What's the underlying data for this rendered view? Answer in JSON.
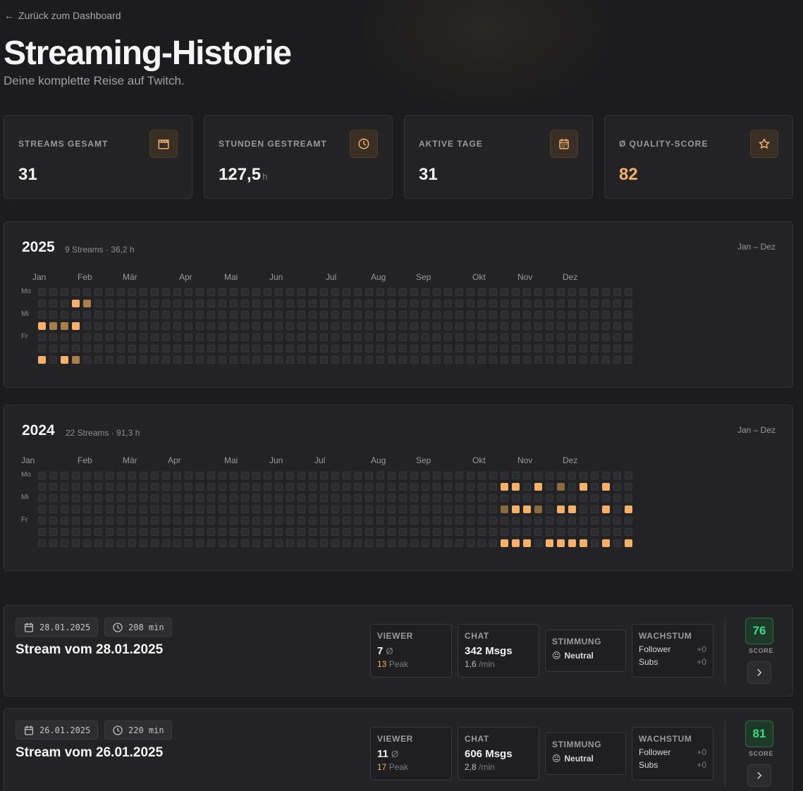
{
  "nav": {
    "back_label": "Zurück zum Dashboard"
  },
  "header": {
    "title": "Streaming-Historie",
    "subtitle": "Deine komplette Reise auf Twitch."
  },
  "colors": {
    "accent": "#f5b06b",
    "score_green": "#3ddc84",
    "background": "#1c1c1e"
  },
  "kpis": [
    {
      "label": "STREAMS GESAMT",
      "value": "31",
      "unit": "",
      "icon": "clapperboard-icon"
    },
    {
      "label": "STUNDEN GESTREAMT",
      "value": "127,5",
      "unit": "h",
      "icon": "clock-icon"
    },
    {
      "label": "AKTIVE TAGE",
      "value": "31",
      "unit": "",
      "icon": "calendar-icon"
    },
    {
      "label": "Ø QUALITY-SCORE",
      "value": "82",
      "unit": "",
      "icon": "star-icon"
    }
  ],
  "weekday_labels": [
    "Mo",
    "Mi",
    "Fr"
  ],
  "heatmaps": [
    {
      "year": "2025",
      "meta": "9 Streams · 36,2 h",
      "range": "Jan – Dez",
      "months": [
        {
          "label": "Jan",
          "week": 0
        },
        {
          "label": "Feb",
          "week": 4
        },
        {
          "label": "Mär",
          "week": 8
        },
        {
          "label": "Apr",
          "week": 13
        },
        {
          "label": "Mai",
          "week": 17
        },
        {
          "label": "Jun",
          "week": 21
        },
        {
          "label": "Jul",
          "week": 26
        },
        {
          "label": "Aug",
          "week": 30
        },
        {
          "label": "Sep",
          "week": 34
        },
        {
          "label": "Okt",
          "week": 39
        },
        {
          "label": "Nov",
          "week": 43
        },
        {
          "label": "Dez",
          "week": 47
        }
      ],
      "active_days": [
        {
          "week": 3,
          "day": 1,
          "level": 3
        },
        {
          "week": 4,
          "day": 1,
          "level": 2
        },
        {
          "week": 0,
          "day": 3,
          "level": 3
        },
        {
          "week": 1,
          "day": 3,
          "level": 2
        },
        {
          "week": 2,
          "day": 3,
          "level": 2
        },
        {
          "week": 3,
          "day": 3,
          "level": 3
        },
        {
          "week": 0,
          "day": 6,
          "level": 3
        },
        {
          "week": 2,
          "day": 6,
          "level": 3
        },
        {
          "week": 3,
          "day": 6,
          "level": 2
        }
      ]
    },
    {
      "year": "2024",
      "meta": "22 Streams · 91,3 h",
      "range": "Jan – Dez",
      "months": [
        {
          "label": "Jan",
          "week": -1
        },
        {
          "label": "Feb",
          "week": 4
        },
        {
          "label": "Mär",
          "week": 8
        },
        {
          "label": "Apr",
          "week": 12
        },
        {
          "label": "Mai",
          "week": 17
        },
        {
          "label": "Jun",
          "week": 21
        },
        {
          "label": "Jul",
          "week": 25
        },
        {
          "label": "Aug",
          "week": 30
        },
        {
          "label": "Sep",
          "week": 34
        },
        {
          "label": "Okt",
          "week": 39
        },
        {
          "label": "Nov",
          "week": 43
        },
        {
          "label": "Dez",
          "week": 47
        }
      ],
      "active_days": [
        {
          "week": 41,
          "day": 1,
          "level": 3
        },
        {
          "week": 42,
          "day": 1,
          "level": 3
        },
        {
          "week": 44,
          "day": 1,
          "level": 3
        },
        {
          "week": 46,
          "day": 1,
          "level": 1
        },
        {
          "week": 48,
          "day": 1,
          "level": 3
        },
        {
          "week": 50,
          "day": 1,
          "level": 3
        },
        {
          "week": 41,
          "day": 3,
          "level": 1
        },
        {
          "week": 42,
          "day": 3,
          "level": 3
        },
        {
          "week": 43,
          "day": 3,
          "level": 3
        },
        {
          "week": 44,
          "day": 3,
          "level": 1
        },
        {
          "week": 46,
          "day": 3,
          "level": 3
        },
        {
          "week": 47,
          "day": 3,
          "level": 3
        },
        {
          "week": 50,
          "day": 3,
          "level": 3
        },
        {
          "week": 52,
          "day": 3,
          "level": 3
        },
        {
          "week": 41,
          "day": 6,
          "level": 3
        },
        {
          "week": 42,
          "day": 6,
          "level": 3
        },
        {
          "week": 43,
          "day": 6,
          "level": 3
        },
        {
          "week": 45,
          "day": 6,
          "level": 3
        },
        {
          "week": 46,
          "day": 6,
          "level": 3
        },
        {
          "week": 47,
          "day": 6,
          "level": 3
        },
        {
          "week": 48,
          "day": 6,
          "level": 3
        },
        {
          "week": 50,
          "day": 6,
          "level": 3
        },
        {
          "week": 52,
          "day": 6,
          "level": 3
        }
      ]
    }
  ],
  "streams": [
    {
      "date": "28.01.2025",
      "duration": "208 min",
      "title": "Stream vom 28.01.2025",
      "viewer_label": "VIEWER",
      "viewer_avg": "7",
      "viewer_avg_sym": "Ø",
      "viewer_peak": "13",
      "viewer_peak_label": "Peak",
      "chat_label": "CHAT",
      "chat_msgs": "342 Msgs",
      "chat_rate": "1,6",
      "chat_rate_unit": "/min",
      "mood_label": "STIMMUNG",
      "mood_emoji": "😐",
      "mood": "Neutral",
      "growth_label": "WACHSTUM",
      "follower_label": "Follower",
      "follower_delta": "+0",
      "subs_label": "Subs",
      "subs_delta": "+0",
      "score": "76",
      "score_label": "SCORE"
    },
    {
      "date": "26.01.2025",
      "duration": "220 min",
      "title": "Stream vom 26.01.2025",
      "viewer_label": "VIEWER",
      "viewer_avg": "11",
      "viewer_avg_sym": "Ø",
      "viewer_peak": "17",
      "viewer_peak_label": "Peak",
      "chat_label": "CHAT",
      "chat_msgs": "606 Msgs",
      "chat_rate": "2,8",
      "chat_rate_unit": "/min",
      "mood_label": "STIMMUNG",
      "mood_emoji": "😐",
      "mood": "Neutral",
      "growth_label": "WACHSTUM",
      "follower_label": "Follower",
      "follower_delta": "+0",
      "subs_label": "Subs",
      "subs_delta": "+0",
      "score": "81",
      "score_label": "SCORE"
    }
  ]
}
